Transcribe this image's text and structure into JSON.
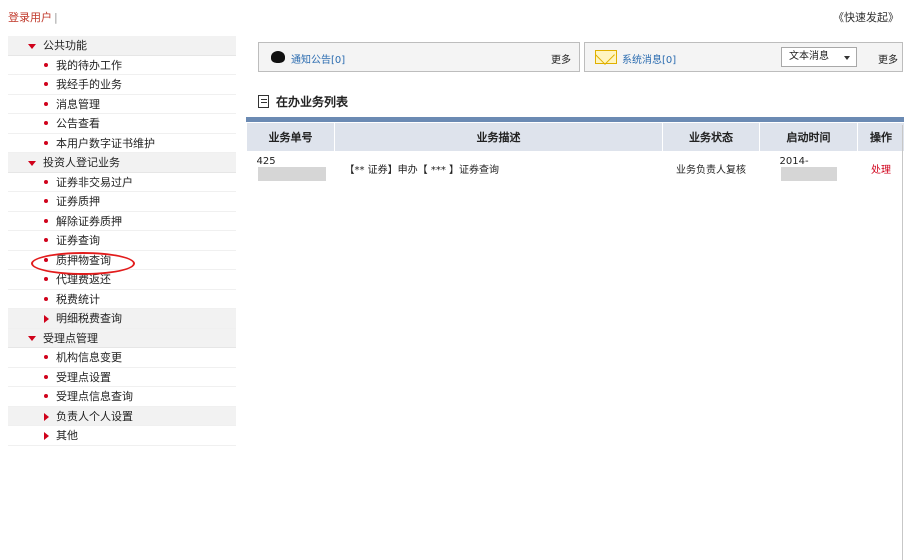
{
  "header": {
    "login_text": "登录用户",
    "separator": "|",
    "quick_link": "《快速发起》"
  },
  "sidebar": {
    "groups": [
      {
        "title": "公共功能",
        "items": [
          "我的待办工作",
          "我经手的业务",
          "消息管理",
          "公告查看",
          "本用户数字证书维护"
        ]
      },
      {
        "title": "投资人登记业务",
        "items": [
          "证券非交易过户",
          "证券质押",
          "解除证券质押",
          "证券查询",
          "质押物查询",
          "代理费返还",
          "税费统计",
          "明细税费查询"
        ]
      },
      {
        "title": "受理点管理",
        "items": [
          "机构信息变更",
          "受理点设置",
          "受理点信息查询",
          "负责人个人设置",
          "其他"
        ]
      }
    ],
    "highlighted_item": "证券查询"
  },
  "notices": {
    "announcement_label": "通知公告[0]",
    "announcement_more": "更多",
    "system_message_label": "系统消息[0]",
    "message_type_select": "文本消息",
    "system_more": "更多"
  },
  "list": {
    "title": "在办业务列表",
    "columns": [
      "业务单号",
      "业务描述",
      "业务状态",
      "启动时间",
      "操作"
    ],
    "rows": [
      {
        "id_prefix": "425",
        "description": "【** 证券】申办【 *** 】证券查询",
        "status": "业务负责人复核",
        "start_prefix": "2014-",
        "action": "处理"
      }
    ]
  },
  "colors": {
    "accent_red": "#d0021b",
    "table_header_bg": "#dee3ec",
    "table_top_bar": "#6b8ab3",
    "link_blue": "#2b6cb0",
    "sidebar_group_bg": "#f2f2f2"
  },
  "icons": {
    "announcement": "bell-icon",
    "system_message": "envelope-icon",
    "list_title": "document-icon",
    "dropdown": "chevron-down-icon"
  }
}
